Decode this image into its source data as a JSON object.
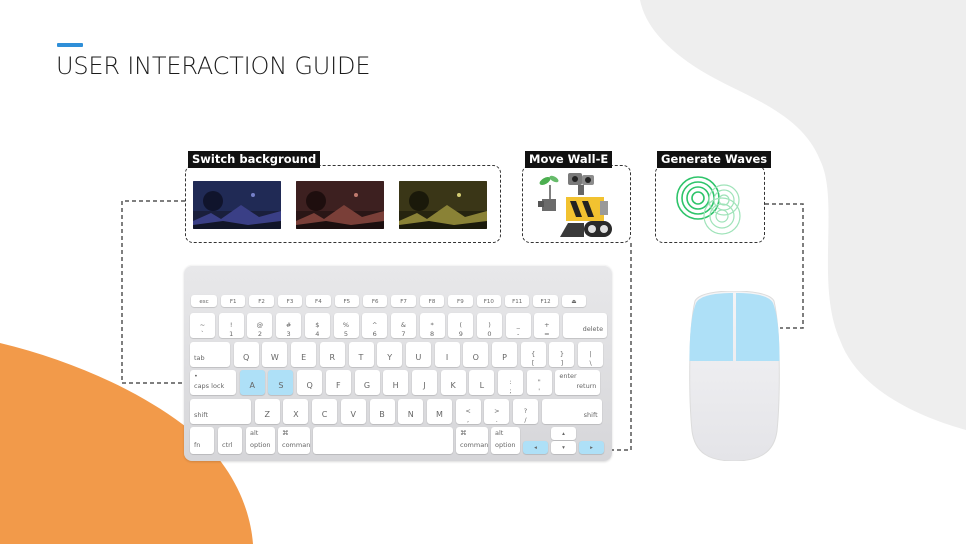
{
  "page": {
    "title": "USER INTERACTION GUIDE"
  },
  "panels": {
    "background": {
      "label": "Switch background",
      "thumbnails": [
        "Night blue",
        "Night red",
        "Night yellow"
      ]
    },
    "walle": {
      "label": "Move Wall-E"
    },
    "waves": {
      "label": "Generate Waves"
    }
  },
  "colors": {
    "accent": "#2f8fd8",
    "highlight": "#aee0f7",
    "orange_blob": "#f29a4a",
    "grey_blob": "#eeeeee",
    "wave_green": "#2ec46a"
  },
  "keyboard": {
    "fn_row": [
      "esc",
      "F1",
      "F2",
      "F3",
      "F4",
      "F5",
      "F6",
      "F7",
      "F8",
      "F9",
      "F10",
      "F11",
      "F12",
      "⏏"
    ],
    "number_row": [
      {
        "top": "~",
        "bottom": "`"
      },
      {
        "top": "!",
        "bottom": "1"
      },
      {
        "top": "@",
        "bottom": "2"
      },
      {
        "top": "#",
        "bottom": "3"
      },
      {
        "top": "$",
        "bottom": "4"
      },
      {
        "top": "%",
        "bottom": "5"
      },
      {
        "top": "^",
        "bottom": "6"
      },
      {
        "top": "&",
        "bottom": "7"
      },
      {
        "top": "*",
        "bottom": "8"
      },
      {
        "top": "(",
        "bottom": "9"
      },
      {
        "top": ")",
        "bottom": "0"
      },
      {
        "top": "_",
        "bottom": "-"
      },
      {
        "top": "+",
        "bottom": "="
      },
      {
        "label": "delete"
      }
    ],
    "qwerty_row": [
      "tab",
      "Q",
      "W",
      "E",
      "R",
      "T",
      "Y",
      "U",
      "I",
      "O",
      "P",
      {
        "top": "{",
        "bottom": "["
      },
      {
        "top": "}",
        "bottom": "]"
      },
      {
        "top": "|",
        "bottom": "\\"
      }
    ],
    "home_row": [
      {
        "top": "•",
        "label": "caps lock"
      },
      "A",
      "S",
      "Q",
      "F",
      "G",
      "H",
      "J",
      "K",
      "L",
      {
        "top": ":",
        "bottom": ";"
      },
      {
        "top": "\"",
        "bottom": "'"
      },
      {
        "top": "enter",
        "label": "return"
      }
    ],
    "shift_row": [
      "shift",
      "Z",
      "X",
      "C",
      "V",
      "B",
      "N",
      "M",
      {
        "top": "<",
        "bottom": ","
      },
      {
        "top": ">",
        "bottom": "."
      },
      {
        "top": "?",
        "bottom": "/"
      },
      "shift"
    ],
    "bottom_row": [
      "fn",
      "ctrl",
      {
        "top": "alt",
        "label": "option"
      },
      {
        "top": "⌘",
        "label": "command"
      },
      "",
      {
        "top": "⌘",
        "label": "command"
      },
      {
        "top": "alt",
        "label": "option"
      },
      "◂",
      "▴",
      "▾",
      "▸"
    ]
  }
}
